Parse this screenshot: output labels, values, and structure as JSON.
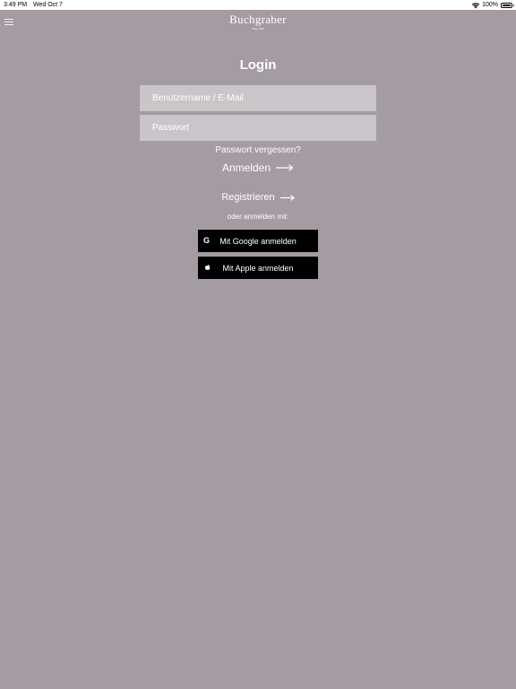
{
  "status_bar": {
    "time": "3:49 PM",
    "date": "Wed Oct 7",
    "battery_percent": "100%",
    "battery_level": 1.0
  },
  "header": {
    "logo_text": "Buchgraber",
    "logo_subtext": "Since 1993",
    "menu_icon": "hamburger-menu-icon"
  },
  "login": {
    "title": "Login",
    "username_placeholder": "Benutzername / E-Mail",
    "username_value": "",
    "password_placeholder": "Passwort",
    "password_value": "",
    "forgot_password": "Passwort vergessen?",
    "login_label": "Anmelden",
    "register_label": "Registrieren",
    "or_text": "oder anmelden mit:",
    "google_label": "Mit Google anmelden",
    "google_icon_glyph": "G",
    "apple_label": "Mit Apple anmelden"
  },
  "colors": {
    "background": "#a49ba3",
    "field_background": "#c9c5c9",
    "social_button": "#000000",
    "text": "#ffffff"
  }
}
